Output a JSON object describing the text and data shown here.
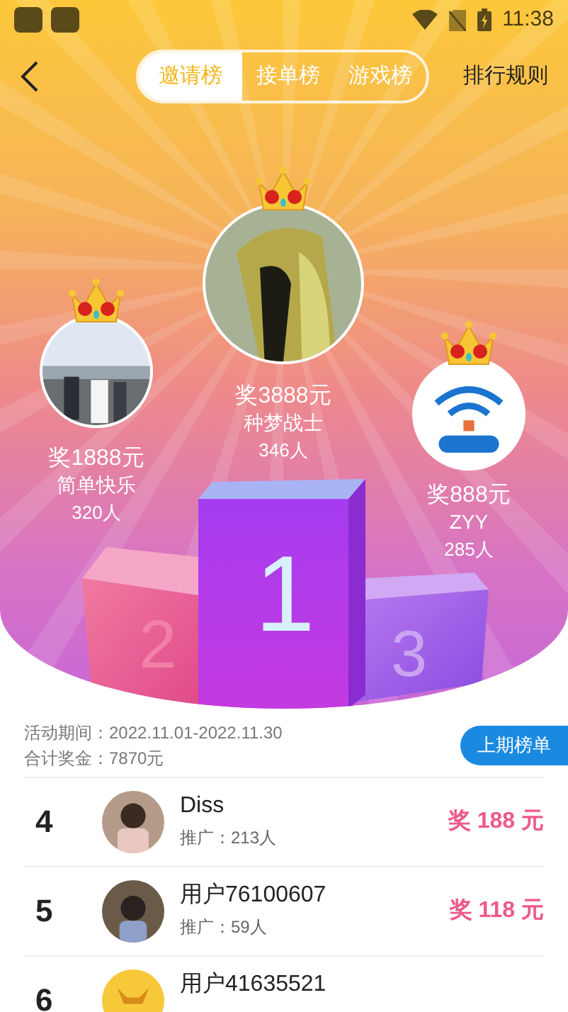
{
  "status_bar": {
    "time": "11:38"
  },
  "header": {
    "tabs": [
      {
        "label": "邀请榜",
        "selected": true
      },
      {
        "label": "接单榜",
        "selected": false
      },
      {
        "label": "游戏榜",
        "selected": false
      }
    ],
    "rules_link": "排行规则"
  },
  "top_three": [
    {
      "prize": "奖1888元",
      "name": "简单快乐",
      "count": "320人"
    },
    {
      "prize": "奖3888元",
      "name": "种梦战士",
      "count": "346人",
      "kind": "drawing"
    },
    {
      "prize": "奖888元",
      "name": "ZYY",
      "count": "285人",
      "kind": "logo"
    }
  ],
  "podium": [
    "2",
    "1",
    "3"
  ],
  "info": {
    "period": "活动期间：2022.11.01-2022.11.30",
    "total": "合计奖金：7870元",
    "button": "上期榜单"
  },
  "ranking": [
    {
      "rank": "4",
      "name": "Diss",
      "promoted": "推广：213人",
      "prize": "奖 188 元"
    },
    {
      "rank": "5",
      "name": "用户76100607",
      "promoted": "推广：59人",
      "prize": "奖 118 元"
    },
    {
      "rank": "6",
      "name": "用户41635521"
    }
  ]
}
